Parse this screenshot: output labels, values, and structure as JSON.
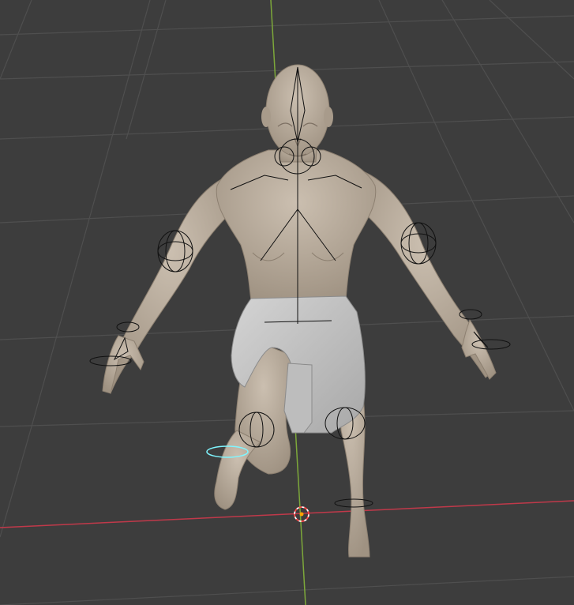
{
  "viewport": {
    "background": "#3d3d3d",
    "grid_color": "#4f4f4f",
    "x_axis_color": "#c0394a",
    "y_axis_color": "#7da83a"
  },
  "model": {
    "skin_color": "#b5a898",
    "cloth_color": "#c4c4c4",
    "rig_color": "#111111",
    "selected_control_color": "#7ff6ff"
  },
  "origin_marker": {
    "icon": "3d-cursor-icon",
    "ring_color": "#ff4545",
    "center_color": "#ffa200"
  }
}
